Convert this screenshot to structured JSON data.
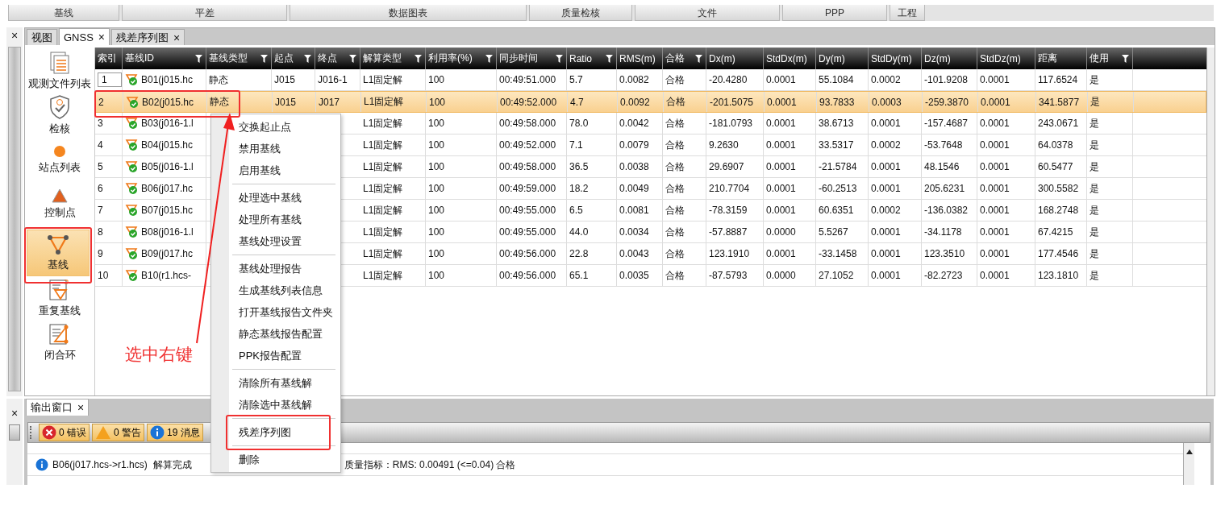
{
  "ribbon": [
    {
      "label": "基线"
    },
    {
      "label": "平差"
    },
    {
      "label": "数据图表"
    },
    {
      "label": "质量检核"
    },
    {
      "label": "文件"
    },
    {
      "label": "PPP"
    },
    {
      "label": "工程"
    }
  ],
  "dock_close": "×",
  "tabs": [
    {
      "label": "视图",
      "closable": false,
      "selected": false
    },
    {
      "label": "GNSS",
      "closable": true,
      "selected": true
    },
    {
      "label": "残差序列图",
      "closable": true,
      "selected": false
    }
  ],
  "tab_close": "×",
  "sidebar": [
    {
      "label": "观测文件列表",
      "selected": false
    },
    {
      "label": "检核",
      "selected": false
    },
    {
      "label": "站点列表",
      "selected": false
    },
    {
      "label": "控制点",
      "selected": false
    },
    {
      "label": "基线",
      "selected": true
    },
    {
      "label": "重复基线",
      "selected": false
    },
    {
      "label": "闭合环",
      "selected": false
    }
  ],
  "table": {
    "columns": [
      {
        "label": "索引",
        "filter": false
      },
      {
        "label": "基线ID",
        "filter": true
      },
      {
        "label": "基线类型",
        "filter": true
      },
      {
        "label": "起点",
        "filter": true
      },
      {
        "label": "终点",
        "filter": true
      },
      {
        "label": "解算类型",
        "filter": true
      },
      {
        "label": "利用率(%)",
        "filter": true
      },
      {
        "label": "同步时间",
        "filter": true
      },
      {
        "label": "Ratio",
        "filter": true
      },
      {
        "label": "RMS(m)",
        "filter": false
      },
      {
        "label": "合格",
        "filter": true
      },
      {
        "label": "Dx(m)",
        "filter": false
      },
      {
        "label": "StdDx(m)",
        "filter": false
      },
      {
        "label": "Dy(m)",
        "filter": false
      },
      {
        "label": "StdDy(m)",
        "filter": false
      },
      {
        "label": "Dz(m)",
        "filter": false
      },
      {
        "label": "StdDz(m)",
        "filter": false
      },
      {
        "label": "距离",
        "filter": false
      },
      {
        "label": "使用",
        "filter": true
      }
    ],
    "rows": [
      {
        "selected": false,
        "editing": true,
        "cells": [
          "1",
          "B01(j015.hc",
          "静态",
          "J015",
          "J016-1",
          "L1固定解",
          "100",
          "00:49:51.000",
          "5.7",
          "0.0082",
          "合格",
          "-20.4280",
          "0.0001",
          "55.1084",
          "0.0002",
          "-101.9208",
          "0.0001",
          "117.6524",
          "是"
        ]
      },
      {
        "selected": true,
        "editing": false,
        "cells": [
          "2",
          "B02(j015.hc",
          "静态",
          "J015",
          "J017",
          "L1固定解",
          "100",
          "00:49:52.000",
          "4.7",
          "0.0092",
          "合格",
          "-201.5075",
          "0.0001",
          "93.7833",
          "0.0003",
          "-259.3870",
          "0.0001",
          "341.5877",
          "是"
        ]
      },
      {
        "selected": false,
        "editing": false,
        "cells": [
          "3",
          "B03(j016-1.l",
          null,
          null,
          null,
          "L1固定解",
          "100",
          "00:49:58.000",
          "78.0",
          "0.0042",
          "合格",
          "-181.0793",
          "0.0001",
          "38.6713",
          "0.0001",
          "-157.4687",
          "0.0001",
          "243.0671",
          "是"
        ]
      },
      {
        "selected": false,
        "editing": false,
        "cells": [
          "4",
          "B04(j015.hc",
          null,
          null,
          null,
          "L1固定解",
          "100",
          "00:49:52.000",
          "7.1",
          "0.0079",
          "合格",
          "9.2630",
          "0.0001",
          "33.5317",
          "0.0002",
          "-53.7648",
          "0.0001",
          "64.0378",
          "是"
        ]
      },
      {
        "selected": false,
        "editing": false,
        "cells": [
          "5",
          "B05(j016-1.l",
          null,
          null,
          null,
          "L1固定解",
          "100",
          "00:49:58.000",
          "36.5",
          "0.0038",
          "合格",
          "29.6907",
          "0.0001",
          "-21.5784",
          "0.0001",
          "48.1546",
          "0.0001",
          "60.5477",
          "是"
        ]
      },
      {
        "selected": false,
        "editing": false,
        "cells": [
          "6",
          "B06(j017.hc",
          null,
          null,
          null,
          "L1固定解",
          "100",
          "00:49:59.000",
          "18.2",
          "0.0049",
          "合格",
          "210.7704",
          "0.0001",
          "-60.2513",
          "0.0001",
          "205.6231",
          "0.0001",
          "300.5582",
          "是"
        ]
      },
      {
        "selected": false,
        "editing": false,
        "cells": [
          "7",
          "B07(j015.hc",
          null,
          null,
          null,
          "L1固定解",
          "100",
          "00:49:55.000",
          "6.5",
          "0.0081",
          "合格",
          "-78.3159",
          "0.0001",
          "60.6351",
          "0.0002",
          "-136.0382",
          "0.0001",
          "168.2748",
          "是"
        ]
      },
      {
        "selected": false,
        "editing": false,
        "cells": [
          "8",
          "B08(j016-1.l",
          null,
          null,
          null,
          "L1固定解",
          "100",
          "00:49:55.000",
          "44.0",
          "0.0034",
          "合格",
          "-57.8887",
          "0.0000",
          "5.5267",
          "0.0001",
          "-34.1178",
          "0.0001",
          "67.4215",
          "是"
        ]
      },
      {
        "selected": false,
        "editing": false,
        "cells": [
          "9",
          "B09(j017.hc",
          null,
          null,
          null,
          "L1固定解",
          "100",
          "00:49:56.000",
          "22.8",
          "0.0043",
          "合格",
          "123.1910",
          "0.0001",
          "-33.1458",
          "0.0001",
          "123.3510",
          "0.0001",
          "177.4546",
          "是"
        ]
      },
      {
        "selected": false,
        "editing": false,
        "cells": [
          "10",
          "B10(r1.hcs-",
          null,
          null,
          null,
          "L1固定解",
          "100",
          "00:49:56.000",
          "65.1",
          "0.0035",
          "合格",
          "-87.5793",
          "0.0000",
          "27.1052",
          "0.0001",
          "-82.2723",
          "0.0001",
          "123.1810",
          "是"
        ]
      }
    ]
  },
  "context_menu": [
    {
      "kind": "item",
      "label": "交换起止点"
    },
    {
      "kind": "item",
      "label": "禁用基线"
    },
    {
      "kind": "item",
      "label": "启用基线"
    },
    {
      "kind": "separator"
    },
    {
      "kind": "item",
      "label": "处理选中基线"
    },
    {
      "kind": "item",
      "label": "处理所有基线"
    },
    {
      "kind": "item",
      "label": "基线处理设置"
    },
    {
      "kind": "separator"
    },
    {
      "kind": "item",
      "label": "基线处理报告"
    },
    {
      "kind": "item",
      "label": "生成基线列表信息"
    },
    {
      "kind": "item",
      "label": "打开基线报告文件夹"
    },
    {
      "kind": "item",
      "label": "静态基线报告配置"
    },
    {
      "kind": "item",
      "label": "PPK报告配置"
    },
    {
      "kind": "separator"
    },
    {
      "kind": "item",
      "label": "清除所有基线解"
    },
    {
      "kind": "item",
      "label": "清除选中基线解"
    },
    {
      "kind": "separator"
    },
    {
      "kind": "item",
      "label": "残差序列图"
    },
    {
      "kind": "separator"
    },
    {
      "kind": "item",
      "label": "删除"
    }
  ],
  "annotation": {
    "label": "选中右键"
  },
  "output": {
    "tab": {
      "label": "输出窗口",
      "selected": true
    },
    "filters": [
      {
        "kind": "error",
        "count": "0",
        "label": "错误",
        "on": true
      },
      {
        "kind": "warning",
        "count": "0",
        "label": "警告",
        "on": true
      },
      {
        "kind": "info",
        "count": "19",
        "label": "消息",
        "on": true
      }
    ],
    "messages": [
      {
        "source": "B06(j017.hcs->r1.hcs)",
        "status": "解算完成",
        "quality": "质量指标：RMS:  0.00491  (<=0.04)  合格"
      }
    ]
  }
}
